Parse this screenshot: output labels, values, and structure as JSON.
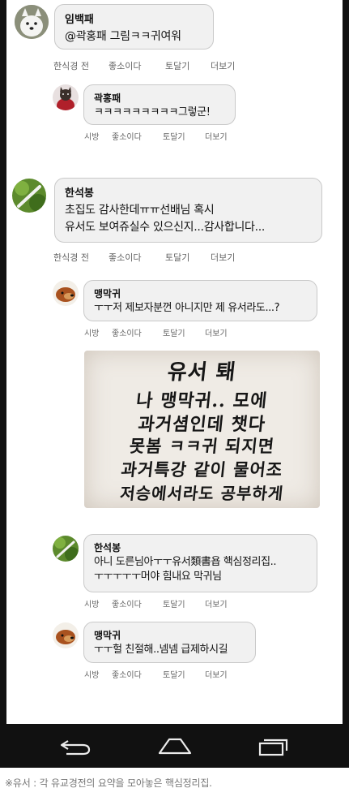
{
  "comments": [
    {
      "author": "임백패",
      "lines": [
        "@곽홍패 그림ㅋㅋ귀여워"
      ],
      "actions": [
        "한식경 전",
        "좋소이다",
        "토달기",
        "더보기"
      ]
    },
    {
      "author": "곽홍패",
      "lines": [
        "ㅋㅋㅋㅋㅋㅋㅋㅋㅋ그렇군!"
      ],
      "actions": [
        "시방",
        "좋소이다",
        "토달기",
        "더보기"
      ]
    },
    {
      "author": "한석봉",
      "lines": [
        "초집도 감사한데ㅠㅠ선배님 혹시",
        "유서도 보여쥬실수 있으신지...감사합니다..."
      ],
      "actions": [
        "한식경 전",
        "좋소이다",
        "토달기",
        "더보기"
      ]
    },
    {
      "author": "맹막귀",
      "lines": [
        "ㅜㅜ저 제보자분껀 아니지만 제 유서라도...?"
      ],
      "actions": [
        "시방",
        "좋소이다",
        "토달기",
        "더보기"
      ]
    },
    {
      "author": "한석봉",
      "lines": [
        "아니 도른님아ㅜㅜ유서類書욥 핵심정리집..",
        "ㅜㅜㅜㅜㅜ머야 힘내요 막귀님"
      ],
      "actions": [
        "시방",
        "좋소이다",
        "토달기",
        "더보기"
      ]
    },
    {
      "author": "맹막귀",
      "lines": [
        "ㅜㅜ헐 친절해..넴넴 급제하시길"
      ],
      "actions": [
        "시방",
        "좋소이다",
        "토달기",
        "더보기"
      ]
    }
  ],
  "handwritten_note": [
    "유서 퇘",
    "나 맹막귀.. 모에",
    "과거셤인데 챗다",
    "못봄 ㅋㅋ귀 되지면",
    "과거특강 같이 물어조",
    "저승에서라도 공부하게"
  ],
  "footnote": "※유서 : 각 유교경전의 요약을 모아놓은 핵심정리집.",
  "nav_icons": [
    "back-icon",
    "home-icon",
    "recent-apps-icon"
  ]
}
